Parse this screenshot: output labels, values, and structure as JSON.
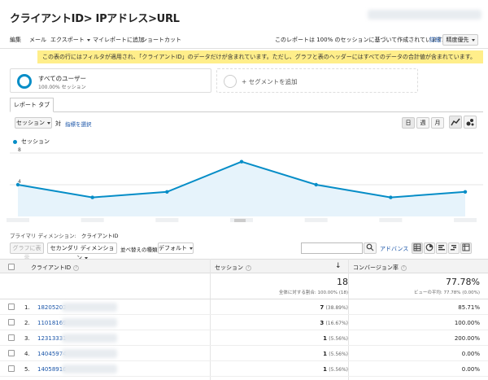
{
  "header": {
    "title": "クライアントID> IPアドレス>URL"
  },
  "toolbar": {
    "items": [
      "編集",
      "メール",
      "エクスポート",
      "マイレポートに追加",
      "ショートカット"
    ],
    "sampling_note": "このレポートは 100% のセッションに基づいて作成されています。",
    "details_link": "詳細",
    "precision_label": "精度優先"
  },
  "notice": {
    "text": "この表の行にはフィルタが適用され、「クライアントID」のデータだけが含まれています。ただし、グラフと表のヘッダーにはすべてのデータの合計値が含まれています。"
  },
  "segments": {
    "active_name": "すべてのユーザー",
    "active_sub": "100.00% セッション",
    "add_label": "+ セグメントを追加"
  },
  "tabs": {
    "report_tab": "レポート タブ"
  },
  "chart_controls": {
    "metric_select": "セッション",
    "vs_label": "対",
    "select_metric_link": "指標を選択",
    "period_day": "日",
    "period_week": "週",
    "period_month": "月"
  },
  "chart_data": {
    "type": "area",
    "legend": "セッション",
    "y_ticks": [
      "8",
      "4"
    ],
    "ylim": [
      0,
      8
    ],
    "values": [
      4,
      2.4,
      3.1,
      6.9,
      4,
      2.4,
      3.1
    ],
    "grid": true,
    "color": "#058dc7"
  },
  "dimension": {
    "label": "プライマリ ディメンション:",
    "value": "クライアントID"
  },
  "table_controls": {
    "plot_rows": "グラフに表示",
    "secondary_dim": "セカンダリ ディメンション",
    "sort_type_label": "並べ替えの種類:",
    "sort_value": "デフォルト",
    "search_placeholder": "",
    "advanced_link": "アドバンス"
  },
  "table": {
    "columns": {
      "client_id": "クライアントID",
      "sessions": "セッション",
      "conversion": "コンバージョン率"
    },
    "totals": {
      "sessions": "18",
      "sessions_sub": "全体に対する割合: 100.00% (18)",
      "conversion": "77.78%",
      "conversion_sub": "ビューの平均: 77.78% (0.00%)"
    },
    "rows": [
      {
        "index": "1.",
        "id": "18205203",
        "sessions": "7",
        "share": "(38.89%)",
        "rate": "85.71%"
      },
      {
        "index": "2.",
        "id": "11018169",
        "sessions": "3",
        "share": "(16.67%)",
        "rate": "100.00%"
      },
      {
        "index": "3.",
        "id": "12313331",
        "sessions": "1",
        "share": "(5.56%)",
        "rate": "200.00%"
      },
      {
        "index": "4.",
        "id": "14045974",
        "sessions": "1",
        "share": "(5.56%)",
        "rate": "0.00%"
      },
      {
        "index": "5.",
        "id": "14058916",
        "sessions": "1",
        "share": "(5.56%)",
        "rate": "0.00%"
      }
    ]
  }
}
